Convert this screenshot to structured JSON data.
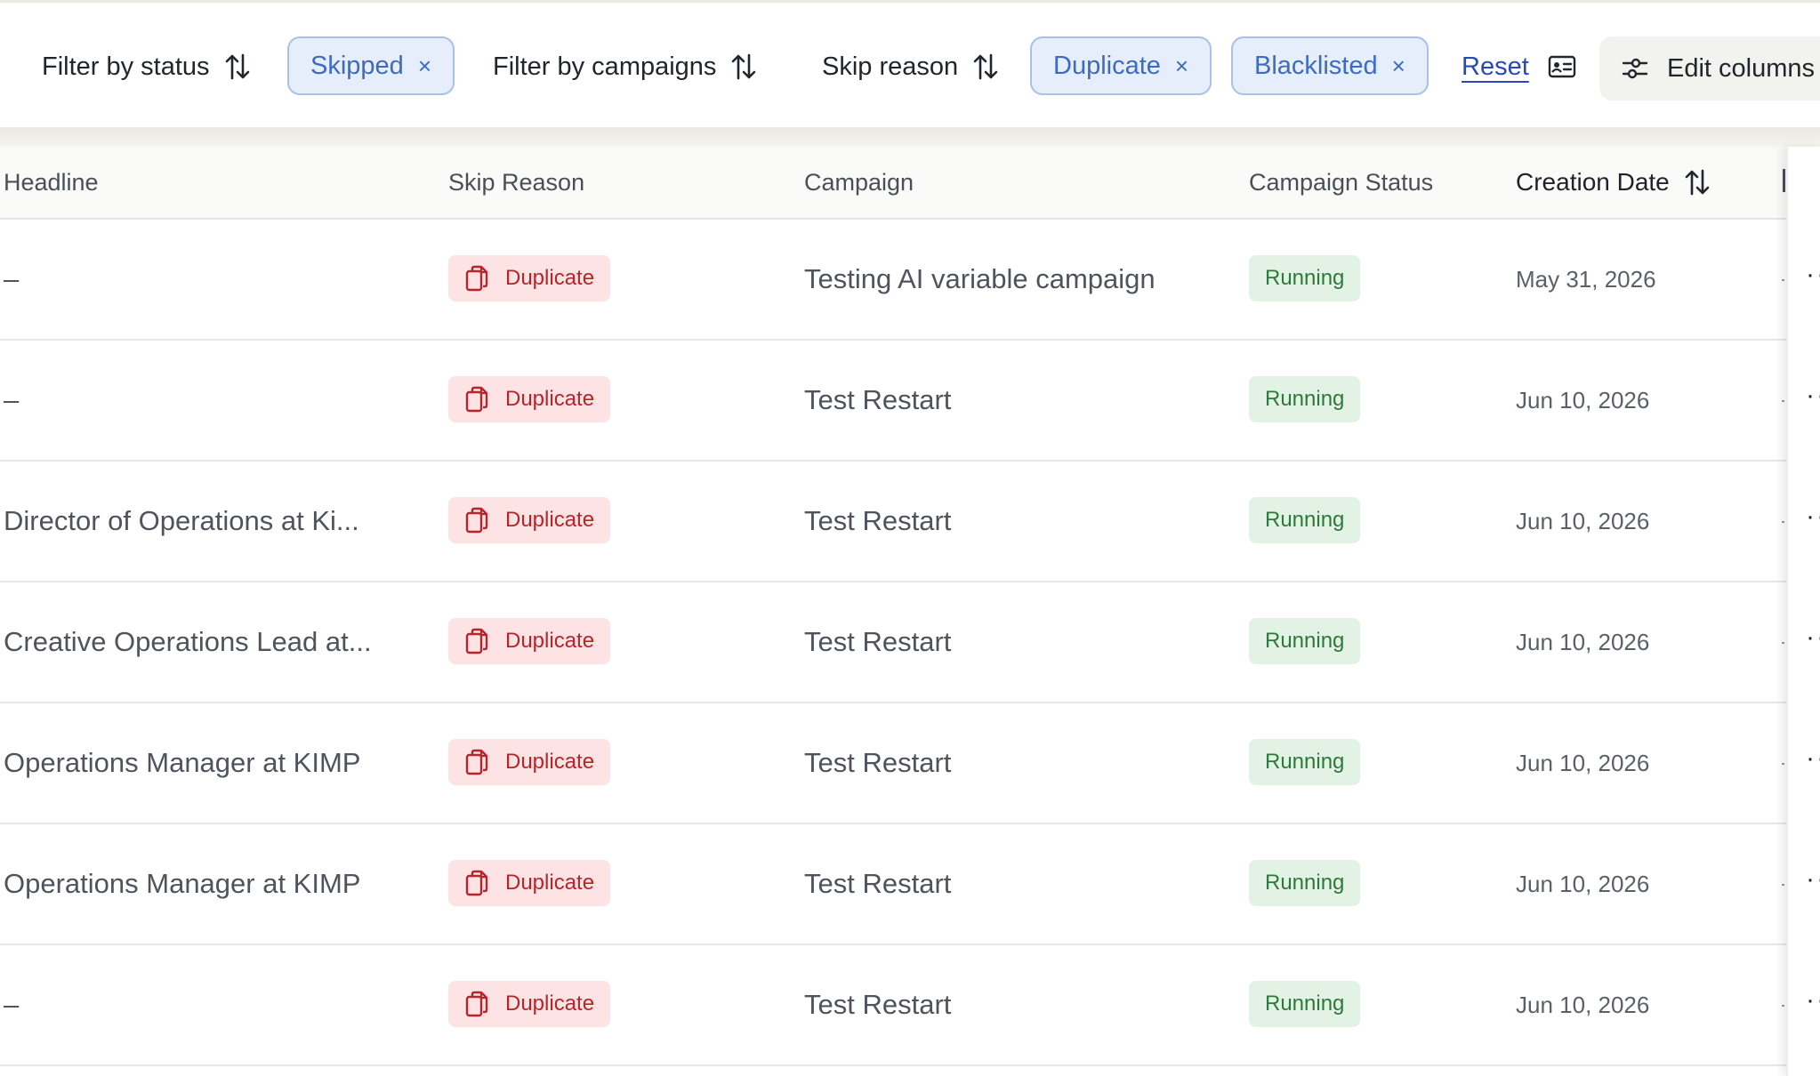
{
  "filters": {
    "status_label": "Filter by status",
    "status_chip": "Skipped",
    "campaigns_label": "Filter by campaigns",
    "skip_reason_label": "Skip reason",
    "skip_chips": [
      "Duplicate",
      "Blacklisted"
    ],
    "reset_label": "Reset",
    "edit_columns_label": "Edit columns",
    "chip_remove_glyph": "×"
  },
  "table": {
    "columns": {
      "headline": "Headline",
      "skip_reason": "Skip Reason",
      "campaign": "Campaign",
      "campaign_status": "Campaign Status",
      "creation_date": "Creation Date"
    },
    "rows": [
      {
        "headline": "–",
        "skip_reason": "Duplicate",
        "campaign": "Testing AI variable campaign",
        "status": "Running",
        "date": "May 31, 2026"
      },
      {
        "headline": "–",
        "skip_reason": "Duplicate",
        "campaign": "Test Restart",
        "status": "Running",
        "date": "Jun 10, 2026"
      },
      {
        "headline": "Director of Operations at Ki...",
        "skip_reason": "Duplicate",
        "campaign": "Test Restart",
        "status": "Running",
        "date": "Jun 10, 2026"
      },
      {
        "headline": "Creative Operations Lead at...",
        "skip_reason": "Duplicate",
        "campaign": "Test Restart",
        "status": "Running",
        "date": "Jun 10, 2026"
      },
      {
        "headline": "Operations Manager at KIMP",
        "skip_reason": "Duplicate",
        "campaign": "Test Restart",
        "status": "Running",
        "date": "Jun 10, 2026"
      },
      {
        "headline": "Operations Manager at KIMP",
        "skip_reason": "Duplicate",
        "campaign": "Test Restart",
        "status": "Running",
        "date": "Jun 10, 2026"
      },
      {
        "headline": "–",
        "skip_reason": "Duplicate",
        "campaign": "Test Restart",
        "status": "Running",
        "date": "Jun 10, 2026"
      }
    ],
    "row_action_glyph": "··"
  },
  "icons": {
    "sort": "sort-arrows-icon",
    "chip_remove": "close-icon",
    "card": "id-card-icon",
    "tune": "sliders-icon",
    "duplicate": "copy-icon"
  },
  "colors": {
    "chip_bg": "#e6eefb",
    "chip_border": "#a9c1e6",
    "chip_text": "#3c6bc2",
    "link": "#2a48b8",
    "duplicate_bg": "#fde3e3",
    "duplicate_text": "#b3262d",
    "running_bg": "#e2f3e5",
    "running_text": "#2e7a3a"
  }
}
